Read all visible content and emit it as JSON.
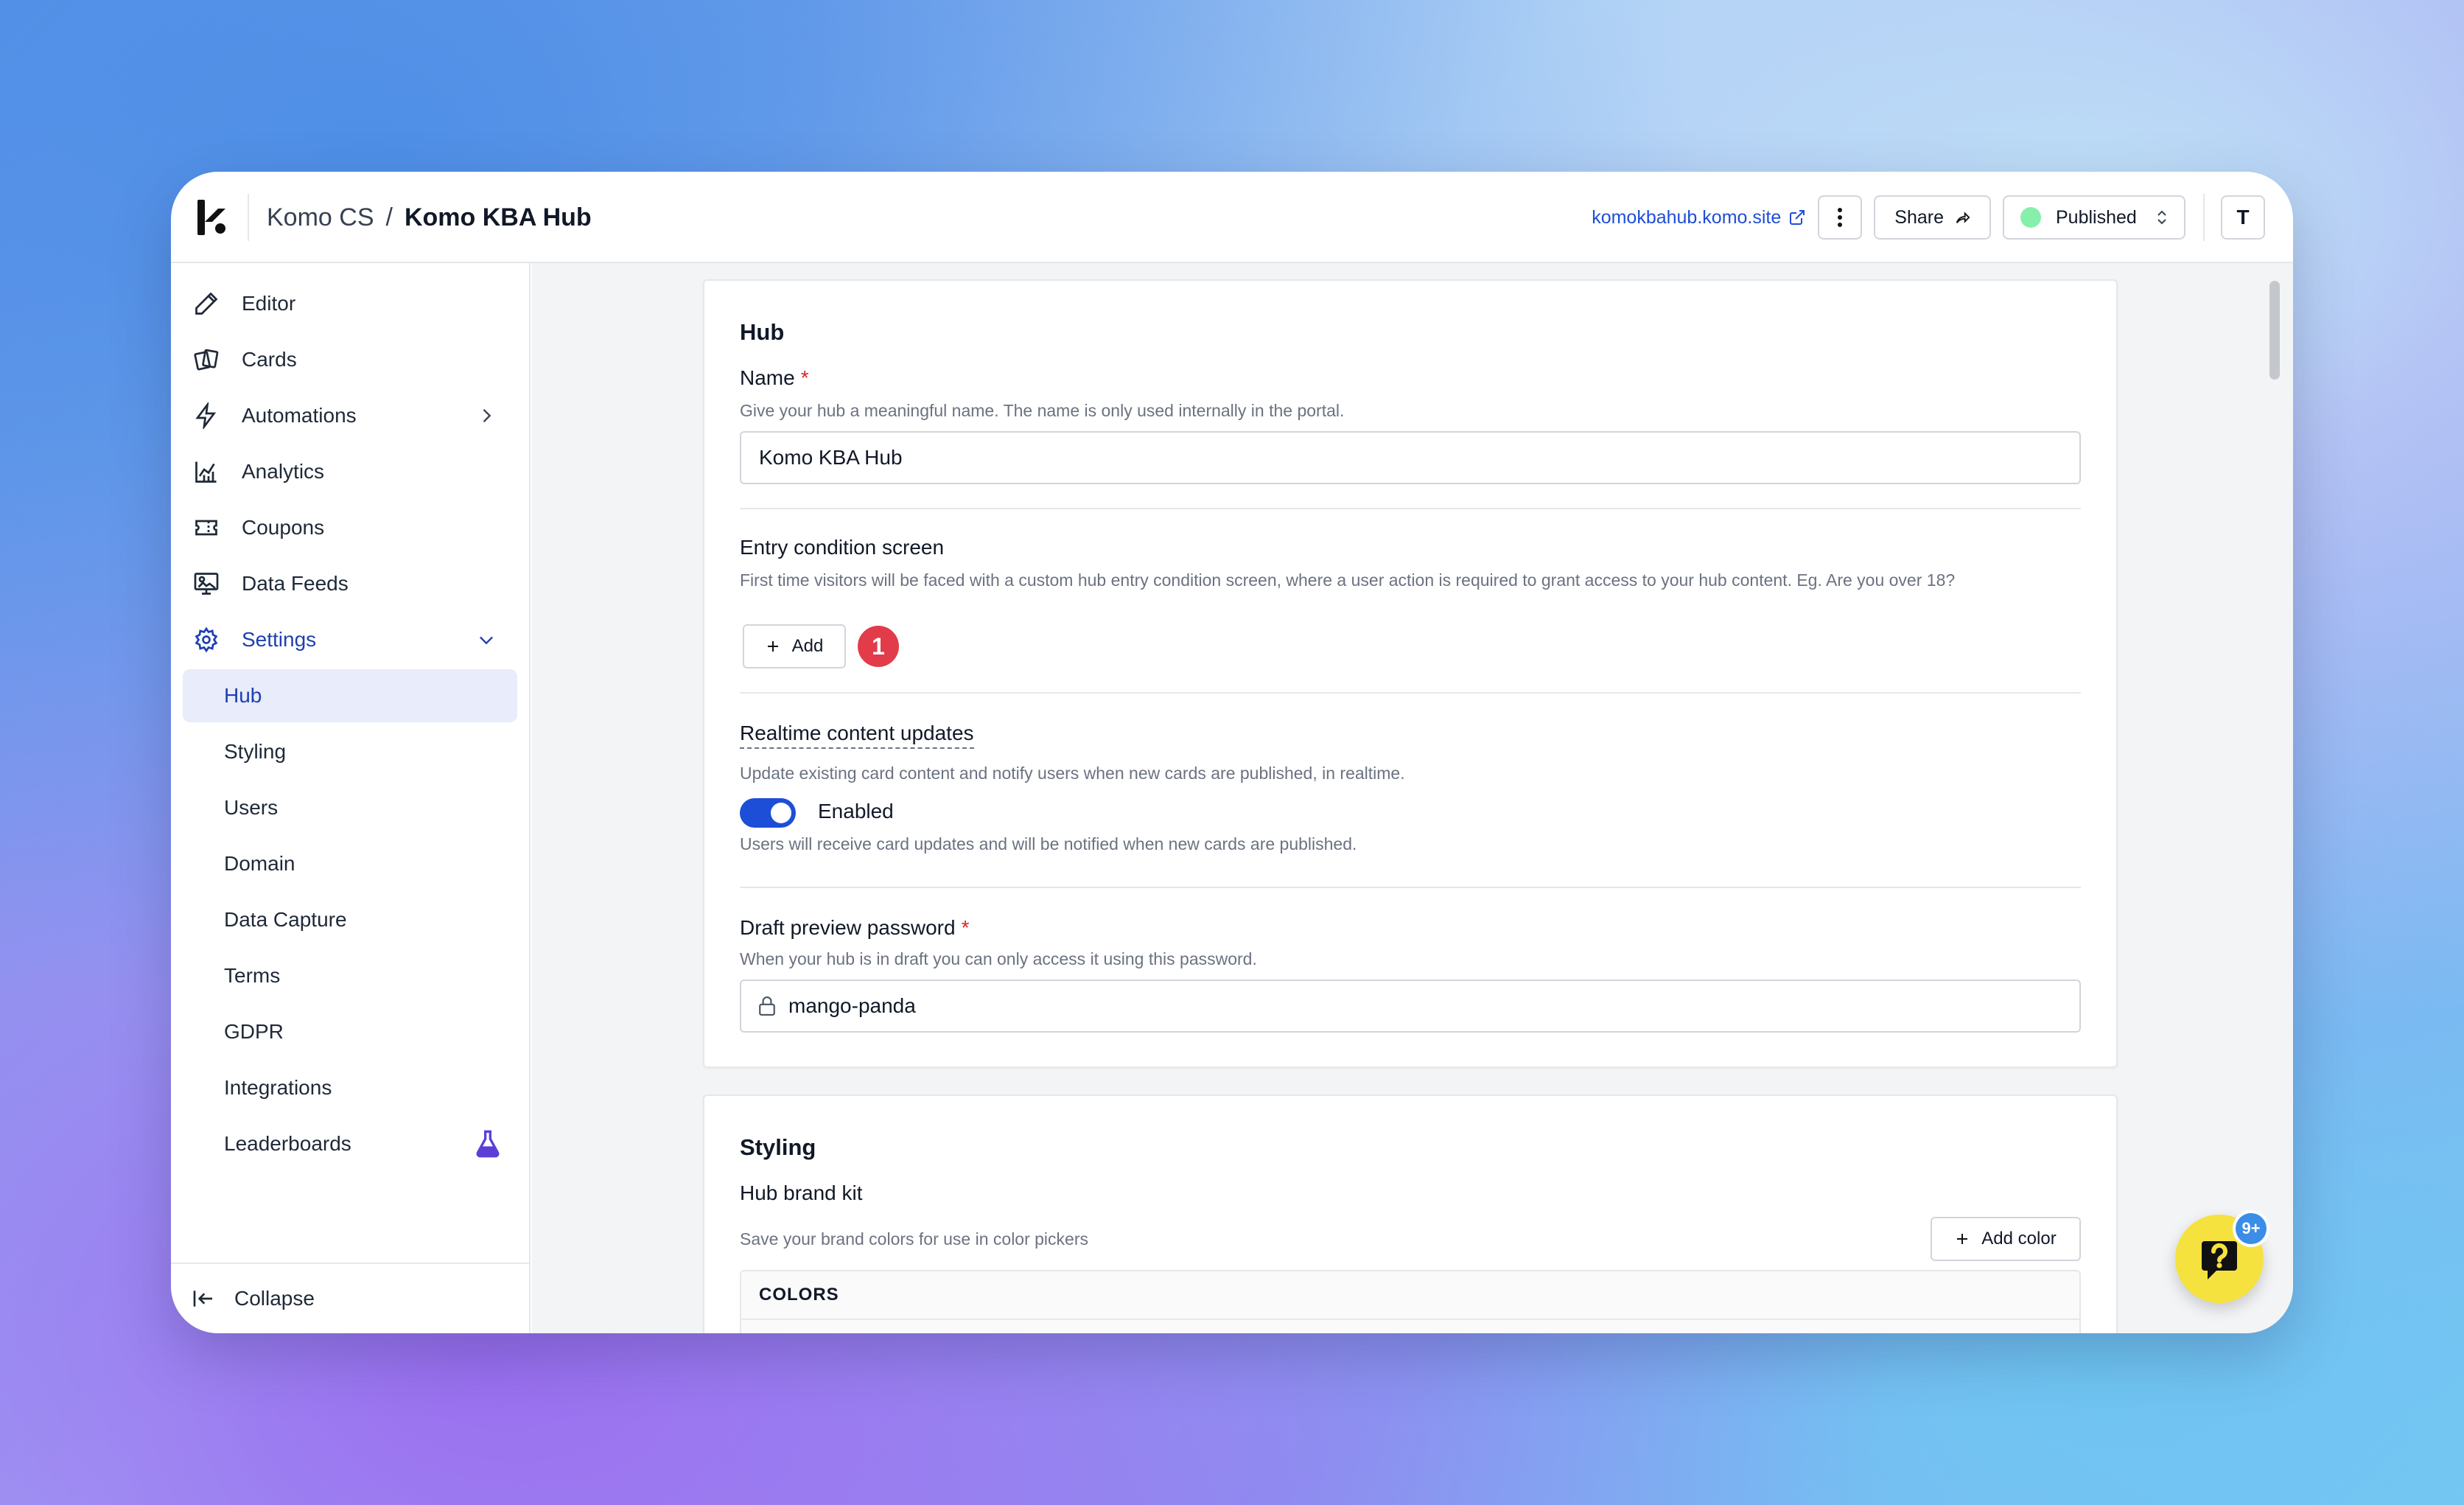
{
  "header": {
    "org": "Komo CS",
    "separator": "/",
    "hub_name": "Komo KBA Hub",
    "site_url": "komokbahub.komo.site",
    "share_label": "Share",
    "status_label": "Published",
    "status_color": "#86efac",
    "avatar_initial": "T"
  },
  "sidebar": {
    "items": [
      {
        "label": "Editor",
        "icon": "pencil-icon"
      },
      {
        "label": "Cards",
        "icon": "cards-icon"
      },
      {
        "label": "Automations",
        "icon": "lightning-icon"
      },
      {
        "label": "Analytics",
        "icon": "chart-icon"
      },
      {
        "label": "Coupons",
        "icon": "ticket-icon"
      },
      {
        "label": "Data Feeds",
        "icon": "data-feed-icon"
      },
      {
        "label": "Settings",
        "icon": "gear-icon"
      }
    ],
    "settings_sub": [
      "Hub",
      "Styling",
      "Users",
      "Domain",
      "Data Capture",
      "Terms",
      "GDPR",
      "Integrations",
      "Leaderboards"
    ],
    "active_sub": "Hub",
    "collapse_label": "Collapse"
  },
  "hub_section": {
    "title": "Hub",
    "name_label": "Name",
    "required_mark": "*",
    "name_help": "Give your hub a meaningful name. The name is only used internally in the portal.",
    "name_value": "Komo KBA Hub",
    "entry_label": "Entry condition screen",
    "entry_help": "First time visitors will be faced with a custom hub entry condition screen, where a user action is required to grant access to your hub content. Eg. Are you over 18?",
    "add_label": "Add",
    "step_badge": "1",
    "realtime_label": "Realtime content updates",
    "realtime_help": "Update existing card content and notify users when new cards are published, in realtime.",
    "toggle_label": "Enabled",
    "toggle_help": "Users will receive card updates and will be notified when new cards are published.",
    "password_label": "Draft preview password",
    "password_help": "When your hub is in draft you can only access it using this password.",
    "password_value": "mango-panda"
  },
  "styling_section": {
    "title": "Styling",
    "brand_kit_label": "Hub brand kit",
    "brand_kit_help": "Save your brand colors for use in color pickers",
    "add_color_label": "Add color",
    "colors_header": "COLORS"
  },
  "help_widget": {
    "badge": "9+"
  },
  "colors": {
    "accent": "#1d4ed8",
    "active_bg": "#e8ecfb",
    "badge_red": "#e23b4a",
    "widget_yellow": "#f6e23e"
  }
}
